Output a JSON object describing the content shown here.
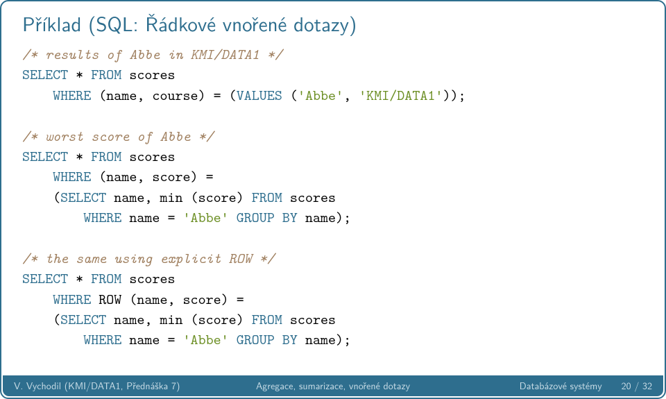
{
  "title": "Příklad (SQL: Řádkové vnořené dotazy)",
  "code": {
    "c1": "/* results of Abbe in KMI/DATA1 */",
    "l1a": "SELECT",
    "l1b": " * ",
    "l1c": "FROM",
    "l1d": " scores",
    "l2a": "    WHERE",
    "l2b": " (name, course) = (",
    "l2c": "VALUES",
    "l2d": " (",
    "l2e": "'Abbe'",
    "l2f": ", ",
    "l2g": "'KMI/DATA1'",
    "l2h": "));",
    "c2": "/* worst score of Abbe */",
    "l3a": "SELECT",
    "l3b": " * ",
    "l3c": "FROM",
    "l3d": " scores",
    "l4a": "    WHERE",
    "l4b": " (name, score) =",
    "l5a": "    (",
    "l5b": "SELECT",
    "l5c": " name, min (score) ",
    "l5d": "FROM",
    "l5e": " scores",
    "l6a": "        WHERE",
    "l6b": " name = ",
    "l6c": "'Abbe'",
    "l6d": " ",
    "l6e": "GROUP BY",
    "l6f": " name);",
    "c3": "/* the same using explicit ROW */",
    "l7a": "SELECT",
    "l7b": " * ",
    "l7c": "FROM",
    "l7d": " scores",
    "l8a": "    WHERE",
    "l8b": " ROW (name, score) =",
    "l9a": "    (",
    "l9b": "SELECT",
    "l9c": " name, min (score) ",
    "l9d": "FROM",
    "l9e": " scores",
    "l10a": "        WHERE",
    "l10b": " name = ",
    "l10c": "'Abbe'",
    "l10d": " ",
    "l10e": "GROUP BY",
    "l10f": " name);"
  },
  "footer": {
    "left": "V. Vychodil (KMI/DATA1, Přednáška 7)",
    "center": "Agregace, sumarizace, vnořené dotazy",
    "right_label": "Databázové systémy",
    "right_page": "20 / 32"
  }
}
